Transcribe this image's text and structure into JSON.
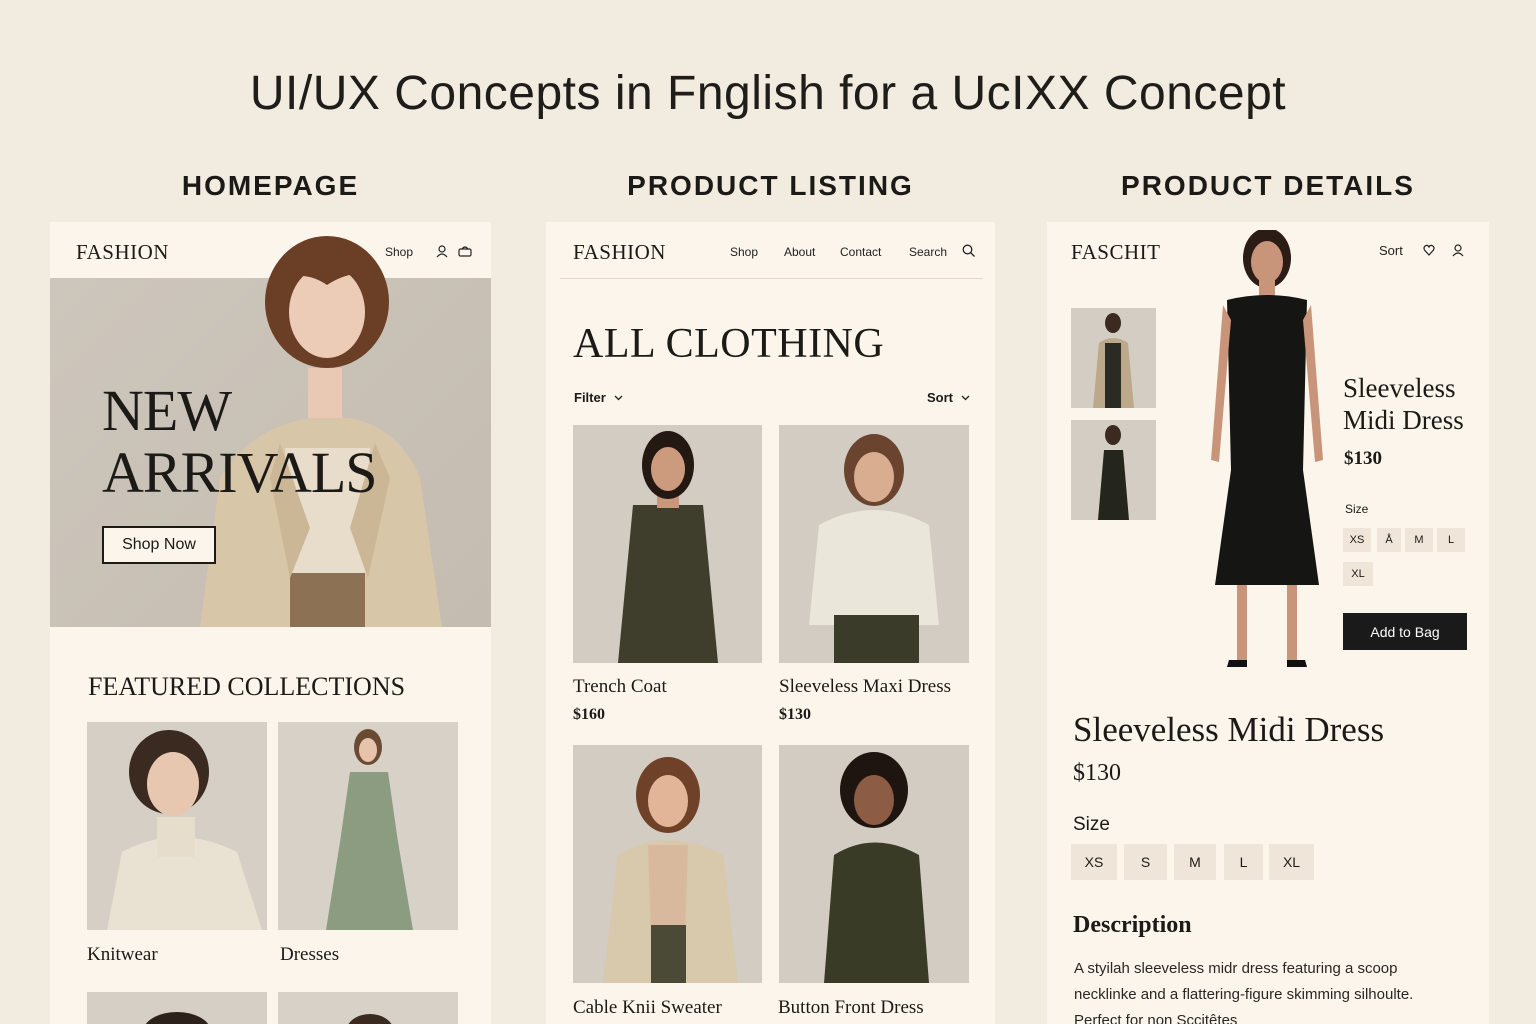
{
  "page": {
    "title": "UI/UX Concepts in Fnglish for a UcIXX Concept"
  },
  "sections": {
    "homepage": "HOMEPAGE",
    "listing": "PRODUCT LISTING",
    "details": "PRODUCT DETAILS"
  },
  "homepage": {
    "brand": "FASHION",
    "nav": {
      "shop": "Shop"
    },
    "icons": [
      "user-icon",
      "bag-icon"
    ],
    "hero": {
      "line1": "NEW",
      "line2": "ARRIVALS",
      "cta": "Shop Now"
    },
    "featured": {
      "heading": "FEATURED COLLECTIONS",
      "items": [
        {
          "label": "Knitwear"
        },
        {
          "label": "Dresses"
        }
      ]
    }
  },
  "listing": {
    "brand": "FASHION",
    "nav": {
      "shop": "Shop",
      "about": "About",
      "contact": "Contact",
      "search": "Search"
    },
    "heading": "ALL CLOTHING",
    "filter": "Filter",
    "sort": "Sort",
    "products": [
      {
        "name": "Trench Coat",
        "price": "$160"
      },
      {
        "name": "Sleeveless Maxi Dress",
        "price": "$130"
      },
      {
        "name": "Cable Knii Sweater",
        "price": ""
      },
      {
        "name": "Button Front Dress",
        "price": ""
      }
    ]
  },
  "details": {
    "brand": "FASCHIT",
    "nav": {
      "sort": "Sort"
    },
    "icons": [
      "heart-icon",
      "user-icon"
    ],
    "side_title_line1": "Sleeveless",
    "side_title_line2": "Midi Dress",
    "side_price": "$130",
    "side_size_label": "Size",
    "side_sizes": [
      "XS",
      "Å",
      "M",
      "L",
      "XL"
    ],
    "add_to_bag": "Add to Bag",
    "title": "Sleeveless Midi Dress",
    "price": "$130",
    "size_label": "Size",
    "sizes": [
      "XS",
      "S",
      "M",
      "L",
      "XL"
    ],
    "description_heading": "Description",
    "description_line1": "A styilah sleeveless midr dress featuring a scoop",
    "description_line2": "necklinke and a flattering-figure skimming silhoulte.",
    "description_line3": "Perfect for non Sccitêtes"
  },
  "colors": {
    "background": "#f1ebe0",
    "panel": "#fbf5ec",
    "chip": "#efe6d9",
    "dark": "#1a1a1a"
  }
}
